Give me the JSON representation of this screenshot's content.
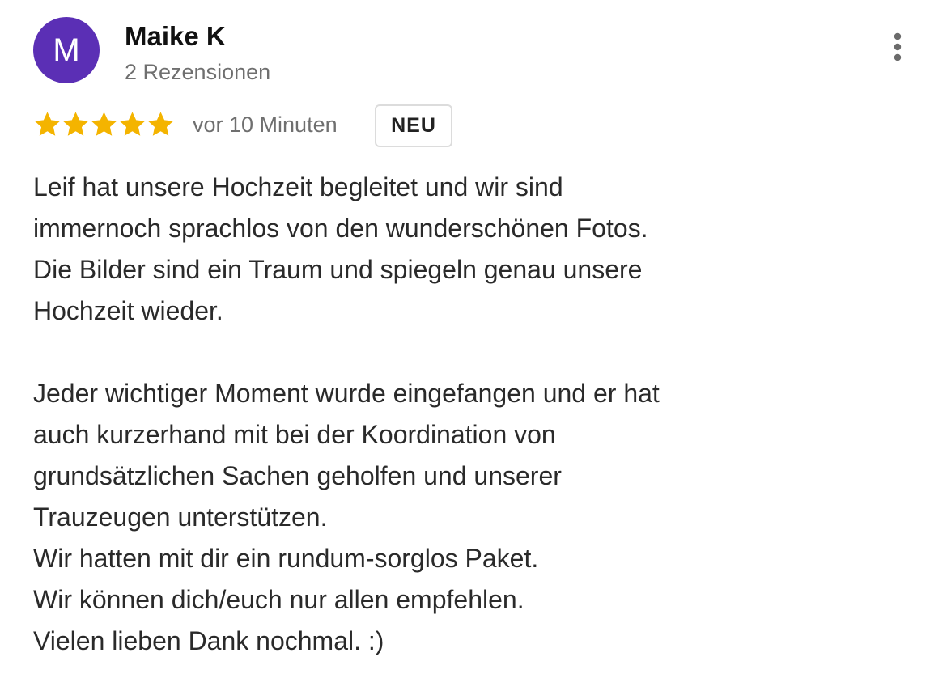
{
  "author": {
    "initial": "M",
    "name": "Maike K",
    "review_count": "2 Rezensionen",
    "avatar_color": "#5b2fb5"
  },
  "rating": {
    "stars": 5,
    "max": 5,
    "star_color": "#f4b400"
  },
  "time": "vor 10 Minuten",
  "badge": "NEU",
  "more_icon": "more-vert-icon",
  "review_text": {
    "lines": [
      "Leif hat unsere Hochzeit begleitet und wir sind",
      "immernoch sprachlos von den wunderschönen Fotos.",
      "Die Bilder sind ein Traum und spiegeln genau unsere",
      "Hochzeit wieder.",
      "",
      "Jeder wichtiger Moment wurde eingefangen und er hat",
      "auch kurzerhand mit bei der Koordination von",
      "grundsätzlichen Sachen geholfen und unserer",
      "Trauzeugen unterstützen.",
      "Wir hatten mit dir ein rundum-sorglos Paket.",
      "Wir können dich/euch nur allen empfehlen.",
      "Vielen lieben Dank nochmal. :)"
    ]
  }
}
